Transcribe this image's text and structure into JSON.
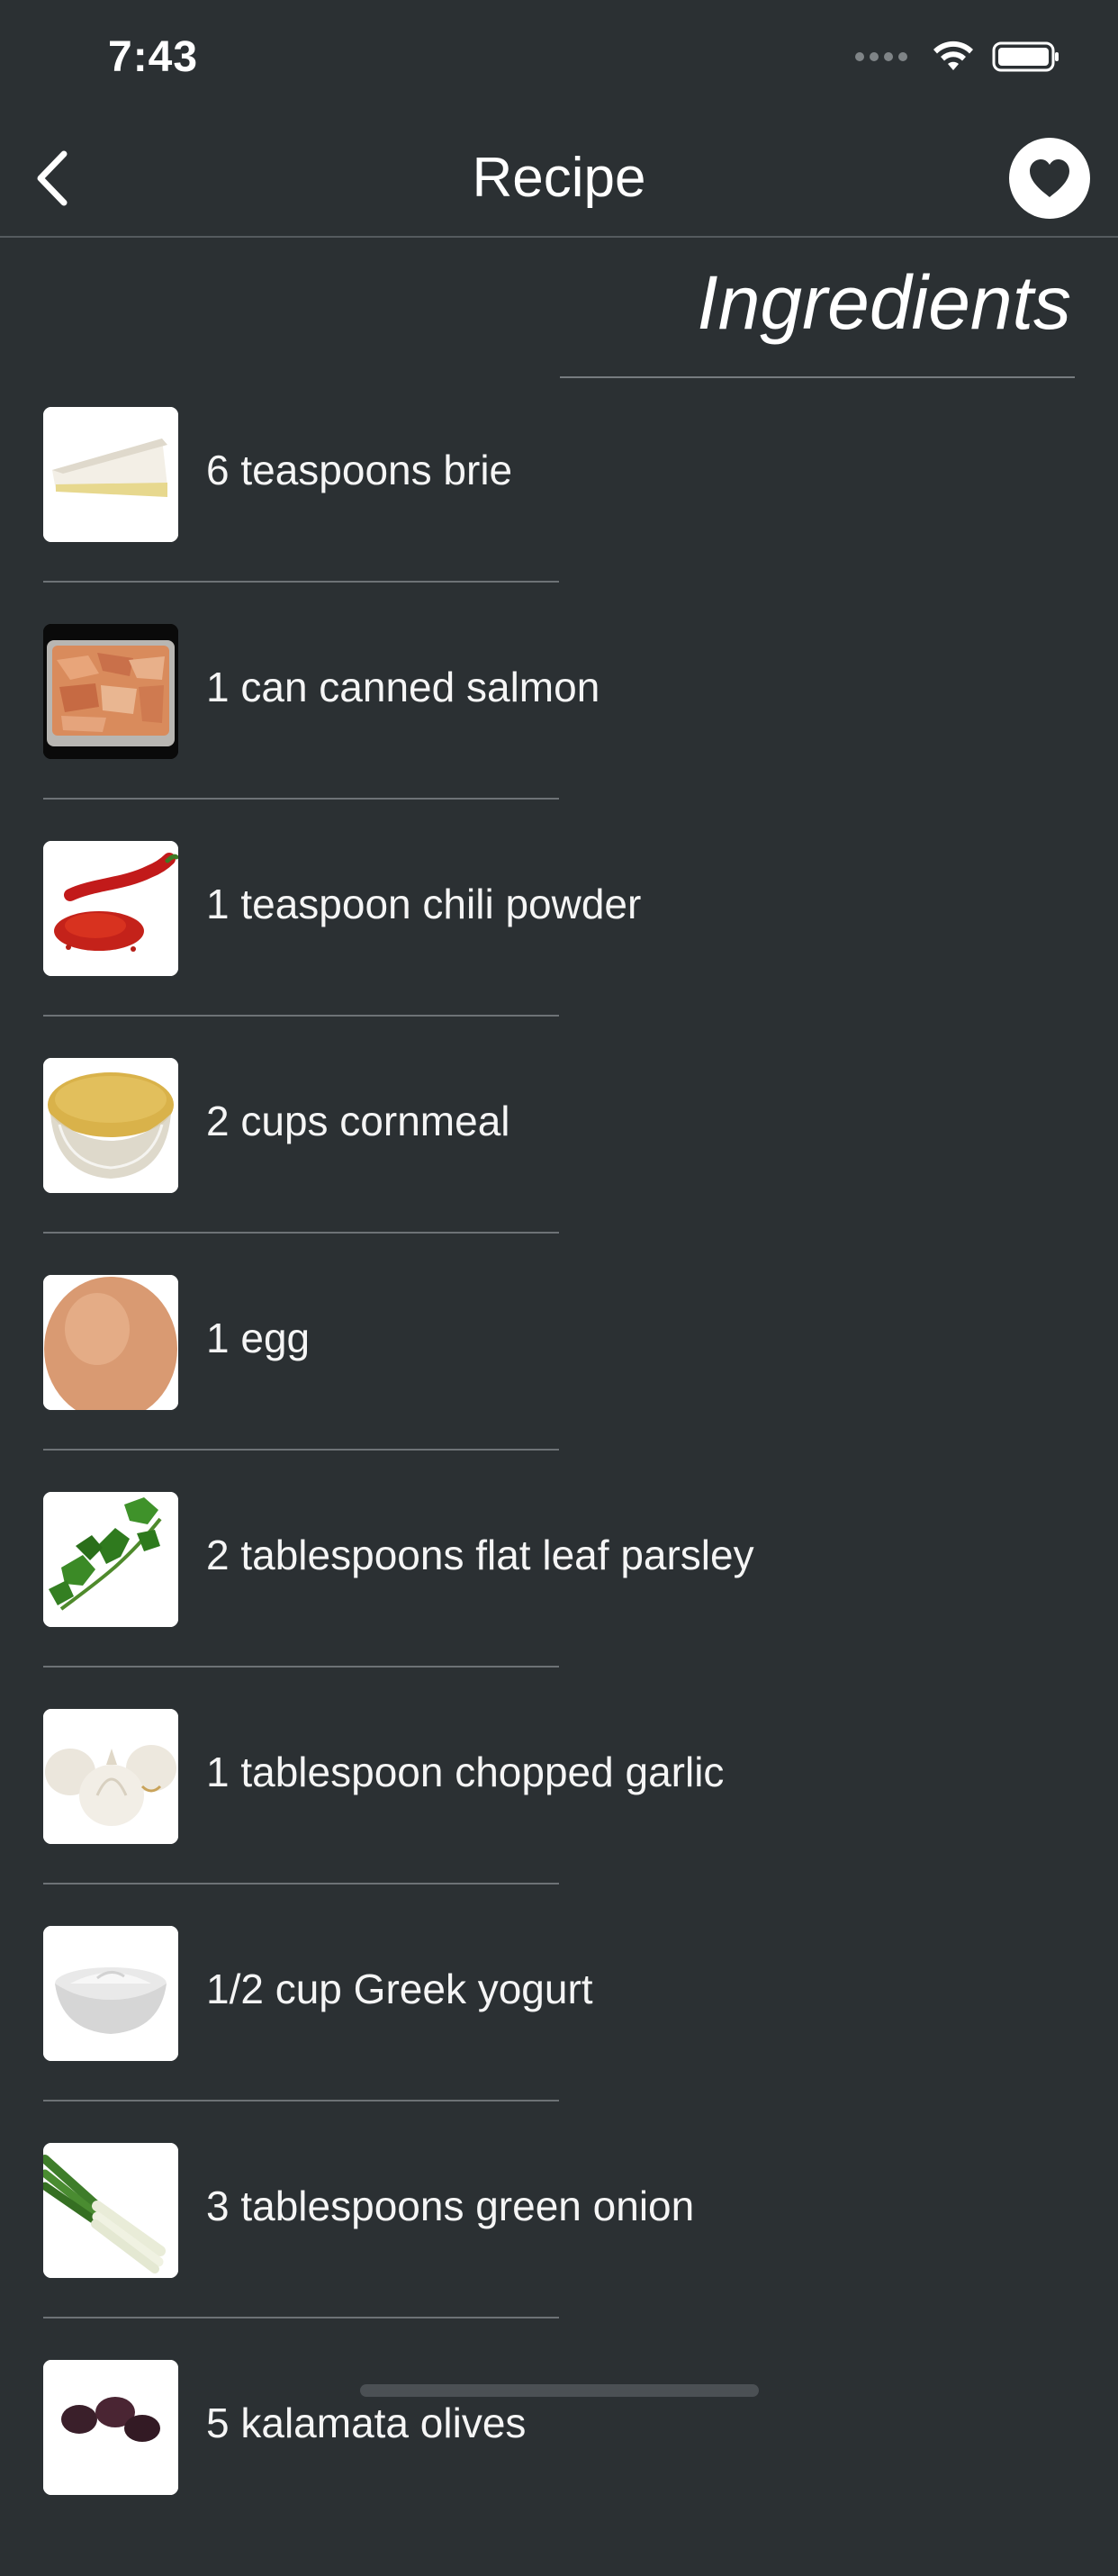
{
  "status_bar": {
    "time": "7:43"
  },
  "header": {
    "title": "Recipe",
    "back_icon": "chevron-left-icon",
    "favorite_icon": "heart-icon"
  },
  "section": {
    "heading": "Ingredients"
  },
  "ingredients": [
    {
      "label": "6 teaspoons brie",
      "icon": "brie-image"
    },
    {
      "label": "1 can canned salmon",
      "icon": "canned-salmon-image"
    },
    {
      "label": "1 teaspoon chili powder",
      "icon": "chili-powder-image"
    },
    {
      "label": "2 cups cornmeal",
      "icon": "cornmeal-image"
    },
    {
      "label": "1 egg",
      "icon": "egg-image"
    },
    {
      "label": "2 tablespoons flat leaf parsley",
      "icon": "parsley-image"
    },
    {
      "label": "1 tablespoon chopped garlic",
      "icon": "garlic-image"
    },
    {
      "label": "1/2 cup Greek yogurt",
      "icon": "greek-yogurt-image"
    },
    {
      "label": "3 tablespoons green onion",
      "icon": "green-onion-image"
    },
    {
      "label": "5 kalamata olives",
      "icon": "kalamata-olives-image"
    }
  ],
  "colors": {
    "background": "#2b3033",
    "text": "#ffffff",
    "divider": "#6d7276"
  }
}
